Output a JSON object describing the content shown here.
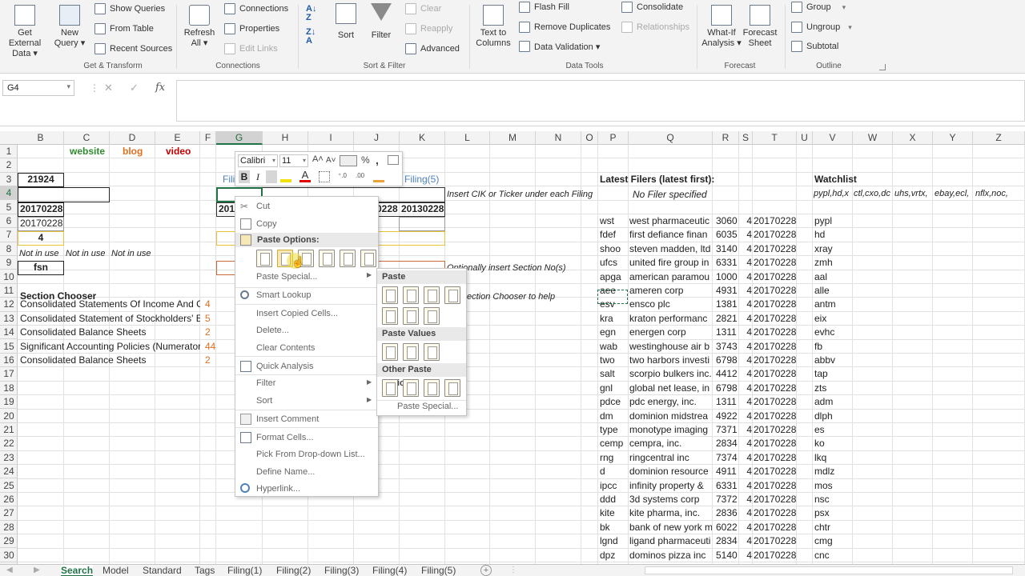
{
  "ribbon": {
    "get_external": "Get External Data ▾",
    "new_query": "New Query ▾",
    "show_queries": "Show Queries",
    "from_table": "From Table",
    "recent_sources": "Recent Sources",
    "get_transform": "Get & Transform",
    "refresh_all": "Refresh All ▾",
    "connections": "Connections",
    "properties": "Properties",
    "edit_links": "Edit Links",
    "connections_group": "Connections",
    "sort": "Sort",
    "filter": "Filter",
    "clear": "Clear",
    "reapply": "Reapply",
    "advanced": "Advanced",
    "sort_filter": "Sort & Filter",
    "text_to_columns": "Text to Columns",
    "flash_fill": "Flash Fill",
    "remove_duplicates": "Remove Duplicates",
    "data_validation": "Data Validation ▾",
    "consolidate": "Consolidate",
    "relationships": "Relationships",
    "data_tools": "Data Tools",
    "what_if": "What-If Analysis ▾",
    "forecast_sheet": "Forecast Sheet",
    "forecast": "Forecast",
    "group": "Group",
    "ungroup": "Ungroup",
    "subtotal": "Subtotal",
    "outline": "Outline"
  },
  "formula": {
    "name_box": "G4",
    "fx": "fx",
    "cancel": "✕",
    "enter": "✓"
  },
  "columns": [
    "B",
    "C",
    "D",
    "E",
    "F",
    "G",
    "H",
    "I",
    "J",
    "K",
    "L",
    "M",
    "N",
    "O",
    "P",
    "Q",
    "R",
    "S",
    "T",
    "U",
    "V",
    "W",
    "X",
    "Y",
    "Z"
  ],
  "rows": [
    "1",
    "2",
    "3",
    "4",
    "5",
    "6",
    "7",
    "8",
    "9",
    "10",
    "11",
    "12",
    "13",
    "14",
    "15",
    "16",
    "17",
    "18",
    "19",
    "20",
    "21",
    "22",
    "23",
    "24",
    "25",
    "26",
    "27",
    "28",
    "29",
    "30"
  ],
  "sheet": {
    "website": "website",
    "blog": "blog",
    "video": "video",
    "b3": "21924",
    "b5": "20170228",
    "b6": "20170228",
    "b7": "4",
    "b8": "Not in use",
    "c8": "Not in use",
    "d8": "Not in use",
    "b9": "fsn",
    "section_chooser": "Section Chooser",
    "sections": [
      {
        "name": "Consolidated Statements Of Income And C",
        "num": "4"
      },
      {
        "name": "Consolidated Statement of Stockholders' E",
        "num": "5"
      },
      {
        "name": "Consolidated Balance Sheets",
        "num": "2"
      },
      {
        "name": "Significant Accounting Policies (Numerator",
        "num": "44"
      },
      {
        "name": "Consolidated Balance Sheets",
        "num": "2"
      }
    ],
    "g3": "Fili",
    "k3": "Filing(5)",
    "g5": "201",
    "j5": "0228",
    "k5": "20130228",
    "l4": "Insert CIK or Ticker under each Filing",
    "l9": "Optionally insert Section No(s)",
    "l11": "ection Chooser to help",
    "latest_title": "Latest Filers (latest first):",
    "no_filer": "No Filer specified",
    "watchlist_title": "Watchlist",
    "watchlist_top": [
      "pypl,hd,x",
      "ctl,cxo,dc",
      "uhs,vrtx,",
      "ebay,ecl,",
      "nflx,noc,"
    ],
    "filers": [
      {
        "tk": "wst",
        "nm": "west pharmaceutic",
        "sic": "3060",
        "n": "4",
        "dt": "20170228",
        "wl": "pypl"
      },
      {
        "tk": "fdef",
        "nm": "first defiance finan",
        "sic": "6035",
        "n": "4",
        "dt": "20170228",
        "wl": "hd"
      },
      {
        "tk": "shoo",
        "nm": "steven madden, ltd",
        "sic": "3140",
        "n": "4",
        "dt": "20170228",
        "wl": "xray"
      },
      {
        "tk": "ufcs",
        "nm": "united fire group in",
        "sic": "6331",
        "n": "4",
        "dt": "20170228",
        "wl": "zmh"
      },
      {
        "tk": "apga",
        "nm": "american paramou",
        "sic": "1000",
        "n": "4",
        "dt": "20170228",
        "wl": "aal"
      },
      {
        "tk": "aee",
        "nm": "ameren corp",
        "sic": "4931",
        "n": "4",
        "dt": "20170228",
        "wl": "alle"
      },
      {
        "tk": "esv",
        "nm": "ensco plc",
        "sic": "1381",
        "n": "4",
        "dt": "20170228",
        "wl": "antm"
      },
      {
        "tk": "kra",
        "nm": "kraton performanc",
        "sic": "2821",
        "n": "4",
        "dt": "20170228",
        "wl": "eix"
      },
      {
        "tk": "egn",
        "nm": "energen corp",
        "sic": "1311",
        "n": "4",
        "dt": "20170228",
        "wl": "evhc"
      },
      {
        "tk": "wab",
        "nm": "westinghouse air b",
        "sic": "3743",
        "n": "4",
        "dt": "20170228",
        "wl": "fb"
      },
      {
        "tk": "two",
        "nm": "two harbors investi",
        "sic": "6798",
        "n": "4",
        "dt": "20170228",
        "wl": "abbv"
      },
      {
        "tk": "salt",
        "nm": "scorpio bulkers inc.",
        "sic": "4412",
        "n": "4",
        "dt": "20170228",
        "wl": "tap"
      },
      {
        "tk": "gnl",
        "nm": "global net lease, in",
        "sic": "6798",
        "n": "4",
        "dt": "20170228",
        "wl": "zts"
      },
      {
        "tk": "pdce",
        "nm": "pdc energy, inc.",
        "sic": "1311",
        "n": "4",
        "dt": "20170228",
        "wl": "adm"
      },
      {
        "tk": "dm",
        "nm": "dominion midstrea",
        "sic": "4922",
        "n": "4",
        "dt": "20170228",
        "wl": "dlph"
      },
      {
        "tk": "type",
        "nm": "monotype imaging",
        "sic": "7371",
        "n": "4",
        "dt": "20170228",
        "wl": "es"
      },
      {
        "tk": "cemp",
        "nm": "cempra, inc.",
        "sic": "2834",
        "n": "4",
        "dt": "20170228",
        "wl": "ko"
      },
      {
        "tk": "rng",
        "nm": "ringcentral inc",
        "sic": "7374",
        "n": "4",
        "dt": "20170228",
        "wl": "lkq"
      },
      {
        "tk": "d",
        "nm": "dominion resource",
        "sic": "4911",
        "n": "4",
        "dt": "20170228",
        "wl": "mdlz"
      },
      {
        "tk": "ipcc",
        "nm": "infinity property &",
        "sic": "6331",
        "n": "4",
        "dt": "20170228",
        "wl": "mos"
      },
      {
        "tk": "ddd",
        "nm": "3d systems corp",
        "sic": "7372",
        "n": "4",
        "dt": "20170228",
        "wl": "nsc"
      },
      {
        "tk": "kite",
        "nm": "kite pharma, inc.",
        "sic": "2836",
        "n": "4",
        "dt": "20170228",
        "wl": "psx"
      },
      {
        "tk": "bk",
        "nm": "bank of new york m",
        "sic": "6022",
        "n": "4",
        "dt": "20170228",
        "wl": "chtr"
      },
      {
        "tk": "lgnd",
        "nm": "ligand pharmaceuti",
        "sic": "2834",
        "n": "4",
        "dt": "20170228",
        "wl": "cmg"
      },
      {
        "tk": "dpz",
        "nm": "dominos pizza inc",
        "sic": "5140",
        "n": "4",
        "dt": "20170228",
        "wl": "cnc"
      }
    ]
  },
  "mini_toolbar": {
    "font": "Calibri",
    "size": "11",
    "bold": "B",
    "italic": "I",
    "percent": "%",
    "comma": ","
  },
  "context_menu": {
    "cut": "Cut",
    "copy": "Copy",
    "paste_options": "Paste Options:",
    "paste_special": "Paste Special...",
    "smart_lookup": "Smart Lookup",
    "insert_copied": "Insert Copied Cells...",
    "delete": "Delete...",
    "clear_contents": "Clear Contents",
    "quick_analysis": "Quick Analysis",
    "filter": "Filter",
    "sort": "Sort",
    "insert_comment": "Insert Comment",
    "format_cells": "Format Cells...",
    "pick_list": "Pick From Drop-down List...",
    "define_name": "Define Name...",
    "hyperlink": "Hyperlink..."
  },
  "submenu": {
    "paste": "Paste",
    "paste_values": "Paste Values",
    "other": "Other Paste Options",
    "paste_special": "Paste Special..."
  },
  "tabs": [
    "Search",
    "Model",
    "Standard",
    "Tags",
    "Filing(1)",
    "Filing(2)",
    "Filing(3)",
    "Filing(4)",
    "Filing(5)"
  ],
  "colors": {
    "website": "#2e8b2e",
    "blog": "#e07020",
    "video": "#c00000",
    "accent": "#217346",
    "yellow": "#e8c43a",
    "orange": "#c8693a"
  }
}
